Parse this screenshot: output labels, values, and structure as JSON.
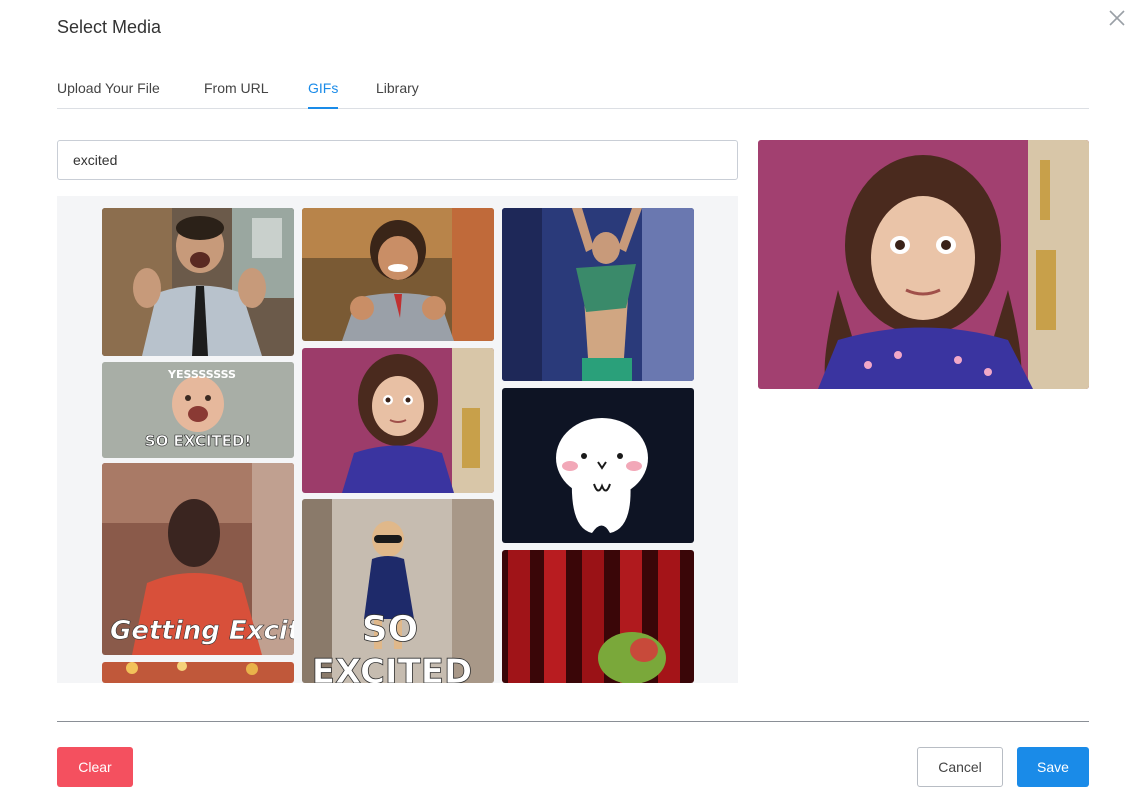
{
  "dialog": {
    "title": "Select Media"
  },
  "tabs": [
    {
      "label": "Upload Your File",
      "active": false
    },
    {
      "label": "From URL",
      "active": false
    },
    {
      "label": "GIFs",
      "active": true
    },
    {
      "label": "Library",
      "active": false
    }
  ],
  "search": {
    "value": "excited"
  },
  "gifs": [
    {
      "id": "man-clapping-tie",
      "caption": ""
    },
    {
      "id": "baby-yessss",
      "caption_top": "YESSSSSSS",
      "caption": "SO EXCITED!"
    },
    {
      "id": "man-getting-excited",
      "caption": "Getting Excited"
    },
    {
      "id": "girl-fists-pumped",
      "caption": ""
    },
    {
      "id": "girl-blue-shirt",
      "caption": ""
    },
    {
      "id": "toddler-sunglasses",
      "caption": "SO",
      "caption2": "EXCITED"
    },
    {
      "id": "man-arms-raised",
      "caption": ""
    },
    {
      "id": "cartoon-ghost",
      "caption": ""
    },
    {
      "id": "kermit-curtain",
      "caption": ""
    },
    {
      "id": "partial-bottom",
      "caption": ""
    }
  ],
  "footer": {
    "clear_label": "Clear",
    "cancel_label": "Cancel",
    "save_label": "Save"
  },
  "colors": {
    "accent": "#1a8be8",
    "danger": "#f4505f",
    "panel_bg": "#f4f5f7"
  },
  "icons": {
    "close": "close-icon"
  }
}
